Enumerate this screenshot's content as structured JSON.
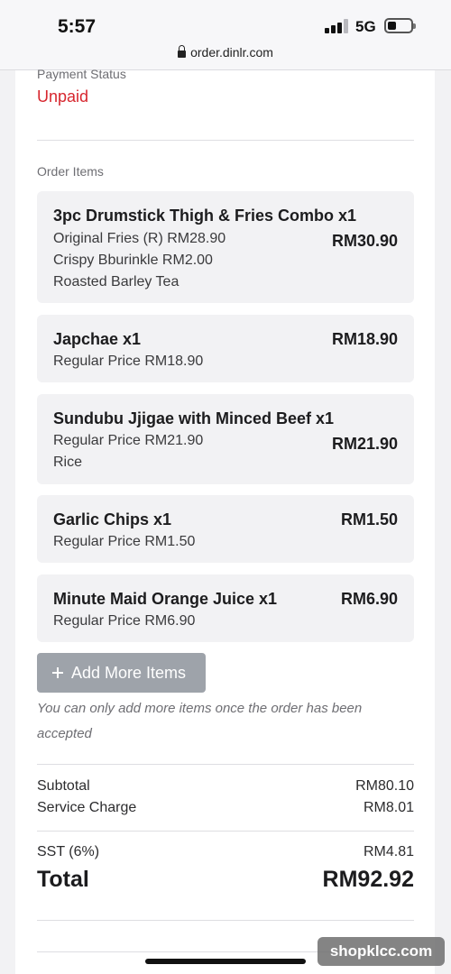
{
  "status_bar": {
    "time": "5:57",
    "network": "5G"
  },
  "browser": {
    "url": "order.dinlr.com"
  },
  "payment": {
    "label": "Payment Status",
    "value": "Unpaid"
  },
  "order_items_label": "Order Items",
  "items": [
    {
      "name": "3pc Drumstick Thigh & Fries Combo x1",
      "price": "RM30.90",
      "details": [
        "Original Fries (R) RM28.90",
        "Crispy Bburinkle RM2.00",
        "Roasted Barley Tea"
      ]
    },
    {
      "name": "Japchae x1",
      "price": "RM18.90",
      "details": [
        "Regular Price RM18.90"
      ]
    },
    {
      "name": "Sundubu Jjigae with Minced Beef x1",
      "price": "RM21.90",
      "details": [
        "Regular Price RM21.90",
        "Rice"
      ]
    },
    {
      "name": "Garlic Chips x1",
      "price": "RM1.50",
      "details": [
        "Regular Price RM1.50"
      ]
    },
    {
      "name": "Minute Maid Orange Juice x1",
      "price": "RM6.90",
      "details": [
        "Regular Price RM6.90"
      ]
    }
  ],
  "add_items": {
    "label": "Add More Items",
    "note": "You can only add more items once the order has been accepted"
  },
  "summary": {
    "subtotal_label": "Subtotal",
    "subtotal": "RM80.10",
    "service_label": "Service Charge",
    "service": "RM8.01",
    "sst_label": "SST (6%)",
    "sst": "RM4.81",
    "total_label": "Total",
    "total": "RM92.92"
  },
  "watermark": "shopklcc.com",
  "colors": {
    "unpaid": "#d7262e",
    "button": "#9ea3aa",
    "item_bg": "#f2f2f4"
  }
}
